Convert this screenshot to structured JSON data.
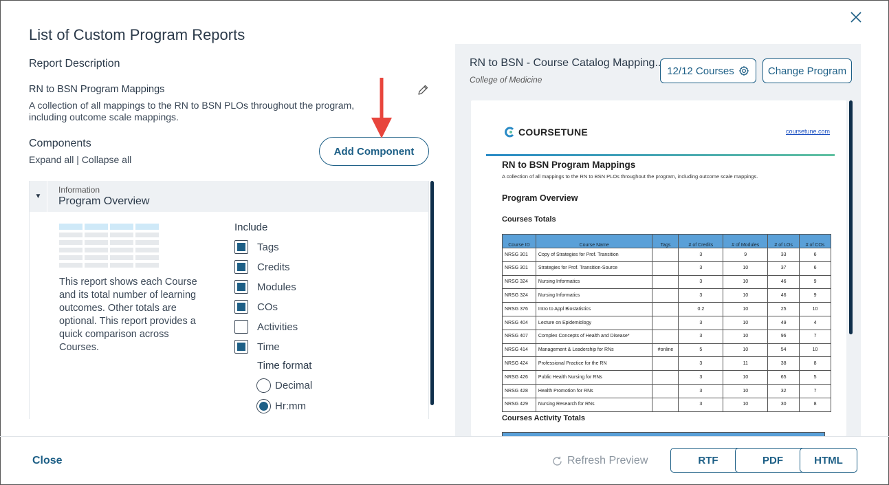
{
  "modal": {
    "title": "List of Custom Program Reports"
  },
  "report": {
    "section_label": "Report Description",
    "name": "RN to BSN Program Mappings",
    "description": "A collection of all mappings to the RN to BSN PLOs throughout the program, including outcome scale mappings."
  },
  "components": {
    "section_label": "Components",
    "expand_all": "Expand all",
    "separator": " | ",
    "collapse_all": "Collapse all",
    "add_button": "Add Component",
    "item": {
      "kind": "Information",
      "name": "Program Overview",
      "description": "This report shows each Course and its total number of learning outcomes. Other totals are optional. This report provides a quick comparison across Courses.",
      "include_label": "Include",
      "options": [
        {
          "label": "Tags",
          "checked": true
        },
        {
          "label": "Credits",
          "checked": true
        },
        {
          "label": "Modules",
          "checked": true
        },
        {
          "label": "COs",
          "checked": true
        },
        {
          "label": "Activities",
          "checked": false
        },
        {
          "label": "Time",
          "checked": true
        }
      ],
      "time_format_label": "Time format",
      "time_formats": [
        {
          "label": "Decimal",
          "selected": false
        },
        {
          "label": "Hr:mm",
          "selected": true
        }
      ]
    }
  },
  "preview": {
    "title": "RN to BSN - Course Catalog Mapping...",
    "subtitle": "College of Medicine",
    "courses_button": "12/12 Courses",
    "change_program_button": "Change Program",
    "doc": {
      "brand": "COURSETUNE",
      "link": "coursetune.com",
      "heading": "RN to BSN Program Mappings",
      "intro": "A collection of all mappings to the RN to BSN PLOs throughout the program, including outcome scale mappings.",
      "section": "Program Overview",
      "table_title": "Courses Totals",
      "columns": [
        "Course ID",
        "Course Name",
        "Tags",
        "# of Credits",
        "# of Modules",
        "# of LOs",
        "# of COs"
      ],
      "rows": [
        [
          "NRSG 301",
          "Copy of Strategies for Prof. Transition",
          "",
          "3",
          "9",
          "33",
          "6"
        ],
        [
          "NRSG 301",
          "Strategies for Prof. Transition-Source",
          "",
          "3",
          "10",
          "37",
          "6"
        ],
        [
          "NRSG 324",
          "Nursing Informatics",
          "",
          "3",
          "10",
          "46",
          "9"
        ],
        [
          "NRSG 324",
          "Nursing Informatics",
          "",
          "3",
          "10",
          "46",
          "9"
        ],
        [
          "NRSG 376",
          "Intro to Appl Biostatistics",
          "",
          "0.2",
          "10",
          "25",
          "10"
        ],
        [
          "NRSG 404",
          "Lecture on Epidemiology",
          "",
          "3",
          "10",
          "49",
          "4"
        ],
        [
          "NRSG 407",
          "Complex Concepts of Health and Disease*",
          "",
          "3",
          "10",
          "96",
          "7"
        ],
        [
          "NRSG 414",
          "Management & Leadership for RNs",
          "#online",
          "5",
          "10",
          "54",
          "10"
        ],
        [
          "NRSG 424",
          "Professional Practice for the RN",
          "",
          "3",
          "11",
          "38",
          "8"
        ],
        [
          "NRSG 426",
          "Public Health Nursing for RNs",
          "",
          "3",
          "10",
          "65",
          "5"
        ],
        [
          "NRSG 428",
          "Health Promotion for RNs",
          "",
          "3",
          "10",
          "32",
          "7"
        ],
        [
          "NRSG 429",
          "Nursing Research for RNs",
          "",
          "3",
          "10",
          "30",
          "8"
        ]
      ],
      "second_table_title": "Courses Activity Totals"
    }
  },
  "footer": {
    "close": "Close",
    "refresh": "Refresh Preview",
    "rtf": "RTF",
    "pdf": "PDF",
    "html": "HTML"
  },
  "colors": {
    "accent": "#1d5f86",
    "arrow": "#e8453c",
    "table_header": "#5aa0d8"
  }
}
